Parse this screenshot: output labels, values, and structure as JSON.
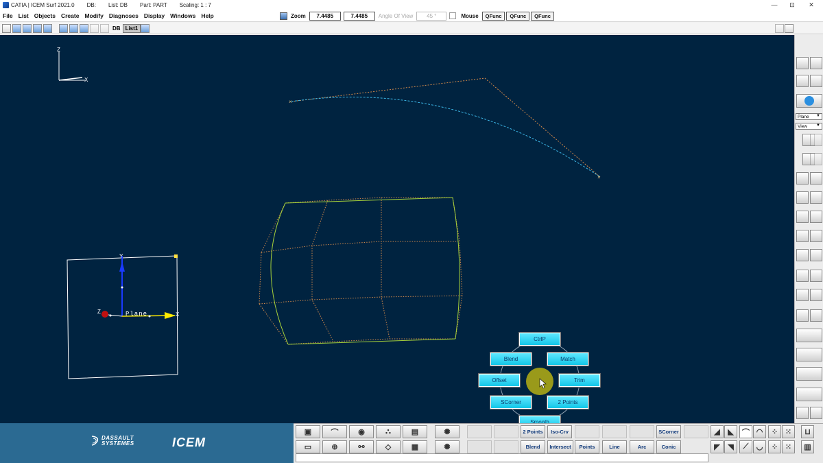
{
  "window": {
    "title": "CATIA | ICEM Surf 2021.0",
    "db": "DB:",
    "list": "List: DB",
    "part": "Part: PART",
    "scaling": "Scaling: 1 : 7",
    "minimize": "—",
    "restore": "⊡",
    "close": "✕"
  },
  "menu": [
    "File",
    "List",
    "Objects",
    "Create",
    "Modify",
    "Diagnoses",
    "Display",
    "Windows",
    "Help"
  ],
  "zoom": {
    "label": "Zoom",
    "value1": "7.4485",
    "value2": "7.4485",
    "angle_label": "Angle Of View",
    "angle_value": "45 °",
    "mouse_label": "Mouse",
    "qfunc": [
      "QFunc",
      "QFunc",
      "QFunc"
    ]
  },
  "toolbar": {
    "db_tag": "DB",
    "list_tag": "List1"
  },
  "viewport": {
    "axis_z": "Z",
    "axis_x": "X",
    "plane_label": "Plane",
    "plane_y": "Y",
    "plane_z": "Z",
    "plane_x": "X"
  },
  "right_palette": {
    "plane_select": "Plane",
    "view_select": "View"
  },
  "brand": {
    "ds_line1": "DASSAULT",
    "ds_line2": "SYSTEMES",
    "icem": "ICEM"
  },
  "bottom_panel": {
    "row1": [
      "",
      "",
      "2 Points",
      "Iso-Crv",
      "",
      "",
      "",
      "SCorner",
      ""
    ],
    "row2": [
      "",
      "",
      "Blend",
      "Intersect",
      "Points",
      "Line",
      "Arc",
      "Conic"
    ]
  },
  "radial_menu": {
    "top": "CtrlP",
    "upper_left": "Blend",
    "upper_right": "Match",
    "left": "Offset",
    "right": "Trim",
    "lower_left": "SCorner",
    "lower_right": "2 Points",
    "bottom": "Smooth"
  },
  "colors": {
    "viewport_bg": "#002340",
    "surface_edge": "#a6d13a",
    "control_poly": "#d08a4a",
    "curve": "#3cb8e8",
    "radial_button": "#1fd0f0",
    "cursor_marker": "#9a9a1a"
  }
}
